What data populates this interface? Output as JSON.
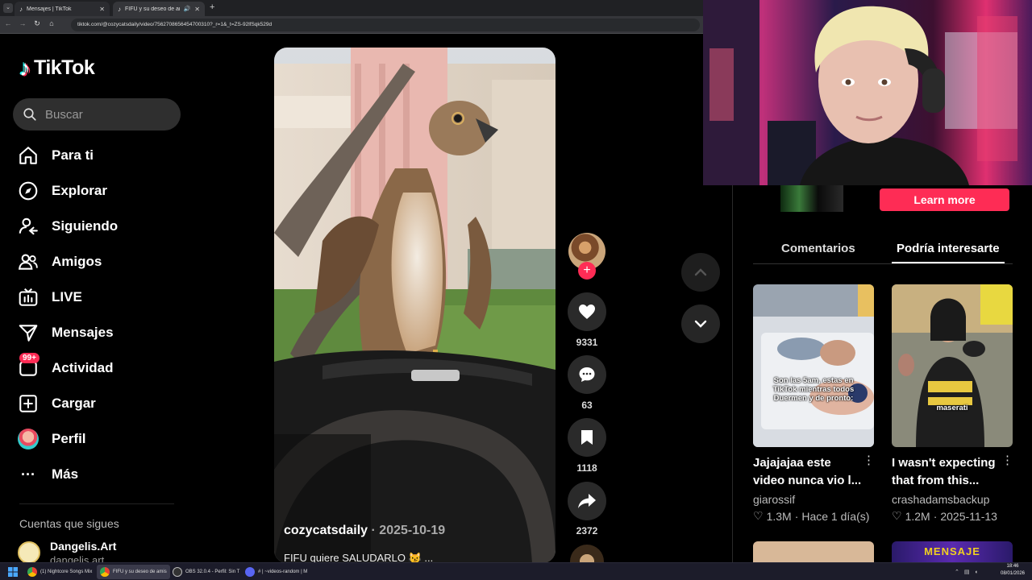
{
  "browser": {
    "tabs": [
      {
        "title": "Mensajes | TikTok"
      },
      {
        "title": "FIFU y su deseo de amistad"
      }
    ],
    "url": "tiktok.com/@cozycatsdaily/video/7562708656454700310?_r=1&_t=ZS-92lfSqk529d"
  },
  "sidebar": {
    "logo_text": "TikTok",
    "search_placeholder": "Buscar",
    "items": [
      {
        "label": "Para ti",
        "icon": "home-icon"
      },
      {
        "label": "Explorar",
        "icon": "compass-icon"
      },
      {
        "label": "Siguiendo",
        "icon": "following-icon"
      },
      {
        "label": "Amigos",
        "icon": "friends-icon"
      },
      {
        "label": "LIVE",
        "icon": "live-icon"
      },
      {
        "label": "Mensajes",
        "icon": "messages-icon"
      },
      {
        "label": "Actividad",
        "icon": "activity-icon",
        "badge": "99+"
      },
      {
        "label": "Cargar",
        "icon": "upload-icon"
      },
      {
        "label": "Perfil",
        "icon": "profile-avatar"
      },
      {
        "label": "Más",
        "icon": "more-icon"
      }
    ],
    "following_title": "Cuentas que sigues",
    "following": [
      {
        "name": "Dangelis.Art",
        "handle": "dangelis.art"
      }
    ]
  },
  "video": {
    "username": "cozycatsdaily",
    "date": "· 2025-10-19",
    "caption": "FIFU quiere SALUDARLO 😼 ..."
  },
  "actions": {
    "likes": "9331",
    "comments": "63",
    "saves": "1118",
    "shares": "2372"
  },
  "right_panel": {
    "ad_button": "Learn more",
    "tabs": [
      "Comentarios",
      "Podría interesarte"
    ],
    "cards": [
      {
        "thumb_caption": "Son las 5am, estas en TikTok mientras todos Duermen y de pronto:",
        "title": "Jajajajaa este video nunca vio l...",
        "author": "giarossif",
        "likes": "1.3M",
        "date": "Hace 1 día(s)"
      },
      {
        "thumb_caption": "maserati",
        "title": "I wasn't expecting that from this...",
        "author": "crashadamsbackup",
        "likes": "1.2M",
        "date": "2025-11-13"
      }
    ],
    "next_thumb_caption": "MENSAJE"
  },
  "taskbar": {
    "items": [
      {
        "label": "(1) Nightcore Songs Mix"
      },
      {
        "label": "FIFU y su deseo de amis"
      },
      {
        "label": "OBS 32.0.4 - Perfil: Sin T"
      },
      {
        "label": "# | ~videos-random | M"
      }
    ],
    "time": "18:46",
    "date": "08/01/2026"
  }
}
